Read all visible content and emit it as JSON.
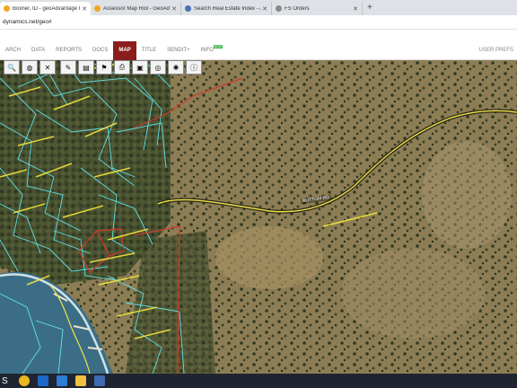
{
  "browser": {
    "tabs": [
      {
        "title": "Boxner, ID - geoAdvantage In",
        "favicon_color": "#f2a81e",
        "active": true
      },
      {
        "title": "Assessor Map Roll - GeoAdvan",
        "favicon_color": "#f2a81e",
        "active": false
      },
      {
        "title": "Search Real Estate Index - AZ R",
        "favicon_color": "#4a6fb5",
        "active": false
      },
      {
        "title": "FS Orders",
        "favicon_color": "#888888",
        "active": false
      }
    ],
    "new_tab": "+",
    "url": "dynamics.net/geo#"
  },
  "app_nav": {
    "items": [
      {
        "label": "ARCH",
        "active": false
      },
      {
        "label": "DATA",
        "active": false
      },
      {
        "label": "REPORTS",
        "active": false
      },
      {
        "label": "DOCS",
        "active": false
      },
      {
        "label": "MAP",
        "active": true
      },
      {
        "label": "TITLE",
        "active": false
      },
      {
        "label": "SENDIT+",
        "active": false
      },
      {
        "label": "INFO",
        "active": false,
        "badge": "NEW"
      }
    ],
    "user_prefs": "USER PREFS"
  },
  "map_toolbar": [
    {
      "icon": "search-icon",
      "glyph": "🔍"
    },
    {
      "icon": "globe-icon",
      "glyph": "◍"
    },
    {
      "icon": "clear-icon",
      "glyph": "✕"
    },
    {
      "icon": "measure-icon",
      "glyph": "✎"
    },
    {
      "icon": "layers-icon",
      "glyph": "▤"
    },
    {
      "icon": "bookmark-icon",
      "glyph": "⚑"
    },
    {
      "icon": "print-icon",
      "glyph": "⎙"
    },
    {
      "icon": "briefcase-icon",
      "glyph": "▣"
    },
    {
      "icon": "target-icon",
      "glyph": "◎"
    },
    {
      "icon": "settings-icon",
      "glyph": "✺"
    },
    {
      "icon": "info-icon",
      "glyph": "ⓘ"
    }
  ],
  "map": {
    "road_label": "BOTTOM RD",
    "colors": {
      "parcel_lines": "#5fe0e6",
      "road": "#f3e14a",
      "highlight_parcel": "#d23a2a",
      "water": "#3b6e86"
    }
  },
  "taskbar": {
    "search_letter": "S",
    "apps": [
      {
        "name": "chrome-icon",
        "color": "#e8b820"
      },
      {
        "name": "outlook-icon",
        "color": "#1b6ac9"
      },
      {
        "name": "windows-icon",
        "color": "#2d7dd2"
      },
      {
        "name": "folder-icon",
        "color": "#f0c040"
      },
      {
        "name": "flag-icon",
        "color": "#3f6bb3"
      }
    ]
  }
}
